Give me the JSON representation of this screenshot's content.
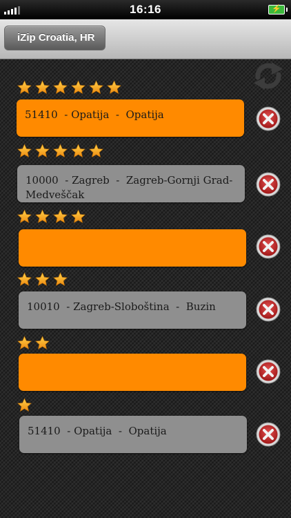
{
  "status_bar": {
    "time": "16:16",
    "battery_icon": "charging-battery-icon",
    "signal_icon": "signal-bars-icon"
  },
  "nav": {
    "back_label": "iZip Croatia, HR"
  },
  "colors": {
    "orange": "#ff8a00",
    "gray": "#8f8f8f",
    "star": "#f6a21a",
    "delete": "#c92c2c"
  },
  "favorites": [
    {
      "stars": 6,
      "text": "51410  - Opatija  -  Opatija",
      "style": "orange"
    },
    {
      "stars": 5,
      "text": "10000  - Zagreb  -  Zagreb-Gornji Grad-Medveščak",
      "style": "gray"
    },
    {
      "stars": 4,
      "text": "",
      "style": "orange"
    },
    {
      "stars": 3,
      "text": "10010  - Zagreb-Sloboština  -  Buzin",
      "style": "gray"
    },
    {
      "stars": 2,
      "text": "",
      "style": "orange"
    },
    {
      "stars": 1,
      "text": "51410  - Opatija  -  Opatija",
      "style": "gray"
    }
  ]
}
